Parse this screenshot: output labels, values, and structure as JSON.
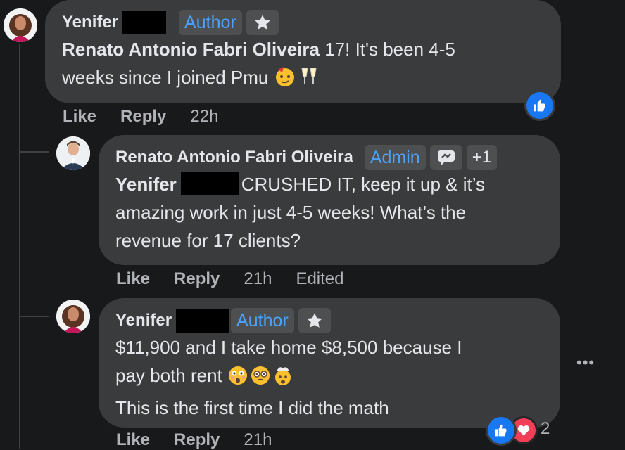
{
  "comment1": {
    "author": "Yenifer",
    "badge": "Author",
    "mention": "Renato Antonio Fabri Oliveira",
    "text_line1": "17! It's been 4-5",
    "text_line2": "weeks since I joined Pmu",
    "actions": {
      "like": "Like",
      "reply": "Reply",
      "time": "22h"
    }
  },
  "comment2": {
    "author": "Renato Antonio Fabri Oliveira",
    "badge": "Admin",
    "extra_badges": "+1",
    "mention": "Yenifer",
    "text_line1": "CRUSHED IT, keep it up & it’s",
    "text_line2": "amazing work in just 4-5 weeks! What’s the",
    "text_line3": "revenue for 17 clients?",
    "actions": {
      "like": "Like",
      "reply": "Reply",
      "time": "21h",
      "edited": "Edited"
    }
  },
  "comment3": {
    "author": "Yenifer",
    "badge": "Author",
    "text_line1": "$11,900 and I take home $8,500 because I",
    "text_line2": "pay both rent",
    "text_line3": "This is the first time I did the math",
    "reactions_count": "2",
    "actions": {
      "like": "Like",
      "reply": "Reply",
      "time": "21h"
    }
  },
  "more_menu": "•••",
  "colors": {
    "background": "#18191a",
    "bubble": "#3a3b3c",
    "badge_bg": "#4e4f50",
    "badge_text": "#4aa3ff",
    "like_blue": "#1877f2",
    "heart_red": "#f33e58"
  }
}
